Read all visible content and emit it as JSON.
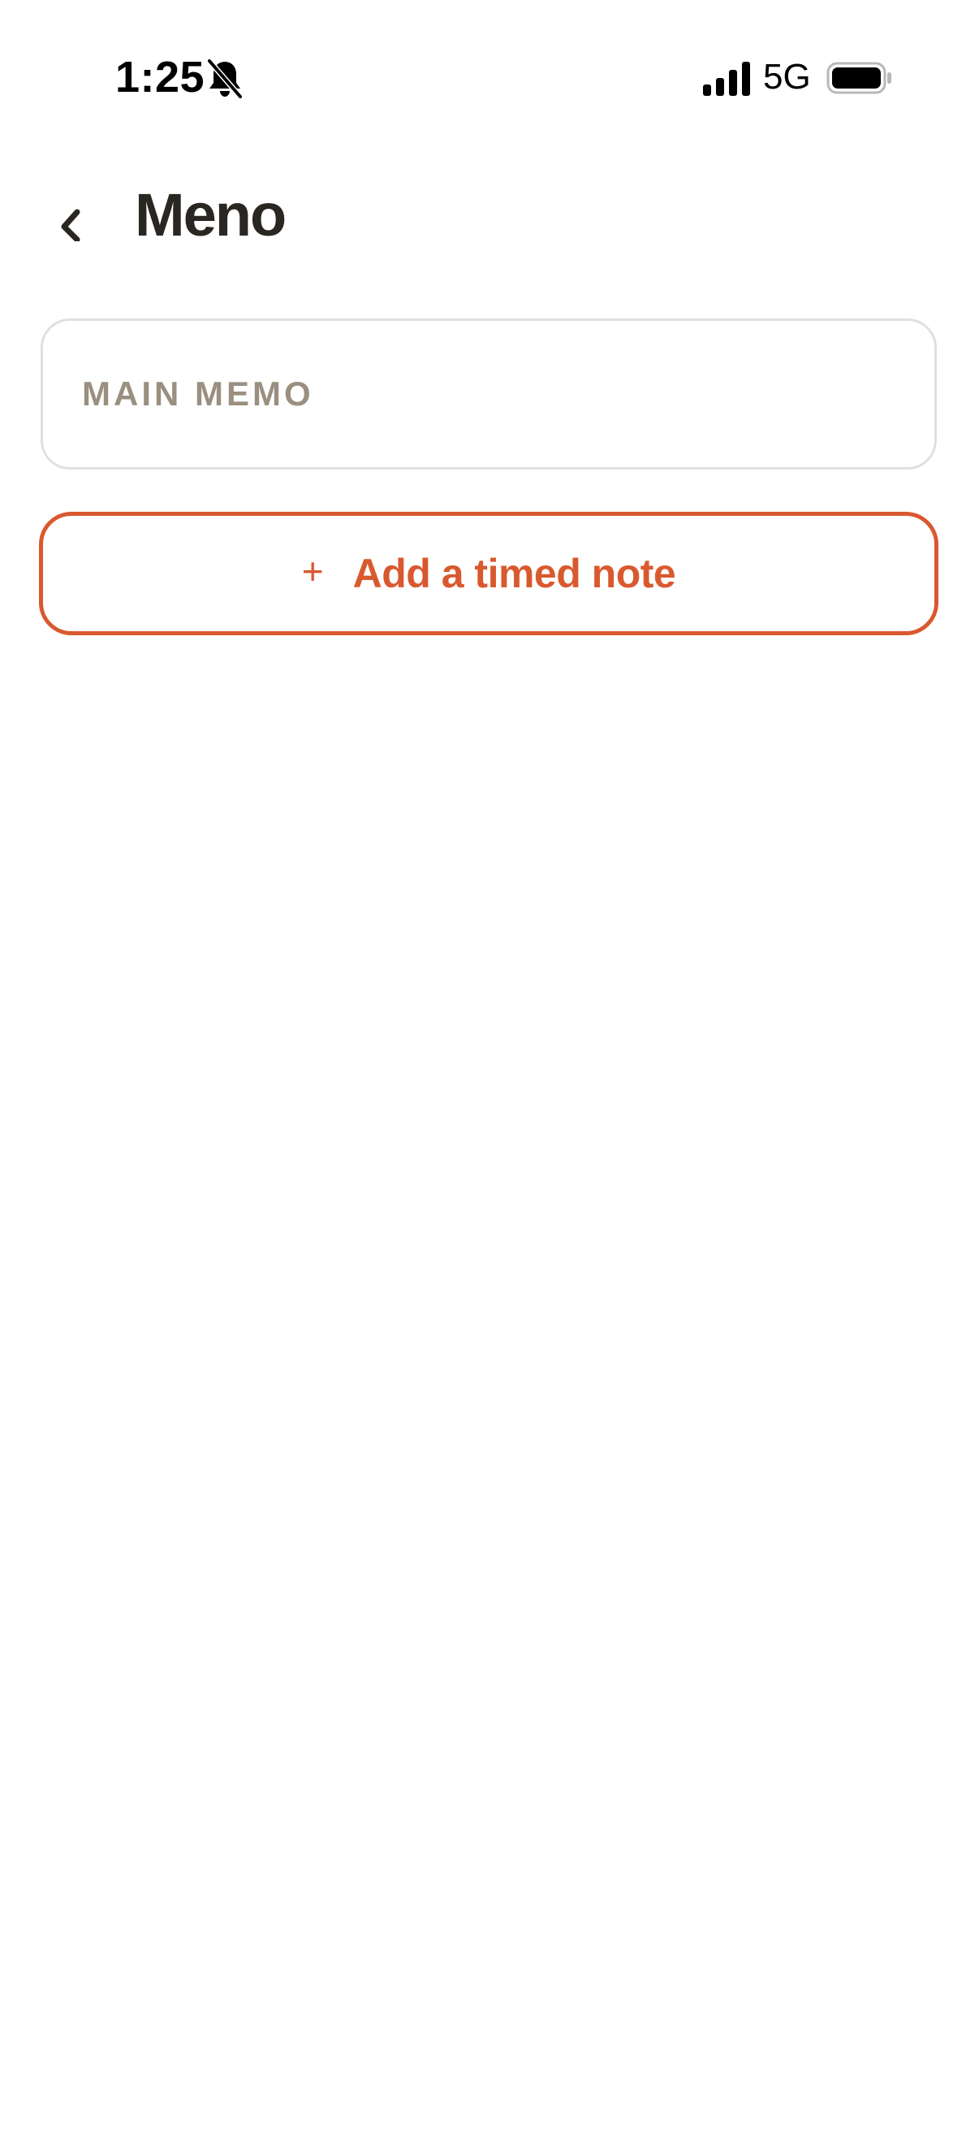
{
  "status_bar": {
    "time": "1:25",
    "network": "5G",
    "icons": [
      "bell-slash-icon",
      "signal-icon",
      "battery-icon"
    ]
  },
  "header": {
    "title": "Meno",
    "back_icon": "chevron-left-icon"
  },
  "memo": {
    "placeholder": "MAIN MEMO",
    "value": ""
  },
  "add_note": {
    "icon": "plus-icon",
    "plus_glyph": "+",
    "label": "Add a timed note"
  },
  "colors": {
    "accent": "#d9592f",
    "text": "#2a2622",
    "placeholder": "#9a8f80",
    "border": "#e2e0dd",
    "background": "#ffffff"
  }
}
